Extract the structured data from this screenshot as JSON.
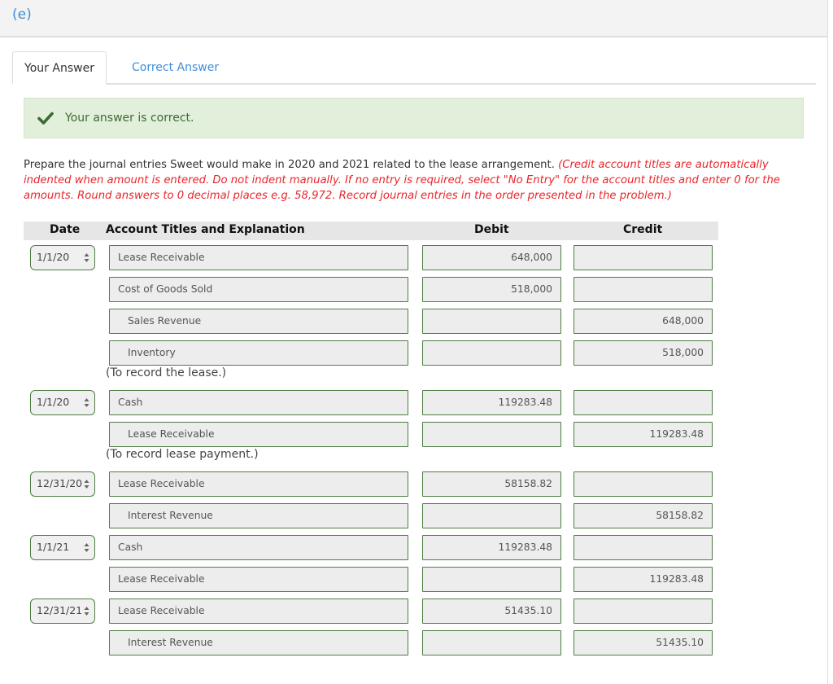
{
  "part_label": "(e)",
  "tabs": [
    {
      "label": "Your Answer",
      "active": true
    },
    {
      "label": "Correct Answer",
      "active": false
    }
  ],
  "alert": {
    "icon": "checkmark-icon",
    "message": "Your answer is correct.",
    "color": "#3b6b34",
    "background": "#e2efda"
  },
  "instructions": {
    "prompt": "Prepare the journal entries Sweet would make in 2020 and 2021 related to the lease arrangement. ",
    "note": "(Credit account titles are automatically indented when amount is entered. Do not indent manually. If no entry is required, select \"No Entry\" for the account titles and enter 0 for the amounts. Round answers to 0 decimal places e.g. 58,972. Record journal entries in the order presented in the problem.)",
    "note_color": "#e8252a"
  },
  "table": {
    "headers": {
      "date": "Date",
      "account": "Account Titles and Explanation",
      "debit": "Debit",
      "credit": "Credit"
    },
    "entries": [
      {
        "date": "1/1/20",
        "lines": [
          {
            "account": "Lease Receivable",
            "indent": false,
            "debit": "648,000",
            "credit": ""
          },
          {
            "account": "Cost of Goods Sold",
            "indent": false,
            "debit": "518,000",
            "credit": ""
          },
          {
            "account": "Sales Revenue",
            "indent": true,
            "debit": "",
            "credit": "648,000"
          },
          {
            "account": "Inventory",
            "indent": true,
            "debit": "",
            "credit": "518,000"
          }
        ],
        "explanation": "(To record the lease.)"
      },
      {
        "date": "1/1/20",
        "lines": [
          {
            "account": "Cash",
            "indent": false,
            "debit": "119283.48",
            "credit": ""
          },
          {
            "account": "Lease Receivable",
            "indent": true,
            "debit": "",
            "credit": "119283.48"
          }
        ],
        "explanation": "(To record lease payment.)"
      },
      {
        "date": "12/31/20",
        "lines": [
          {
            "account": "Lease Receivable",
            "indent": false,
            "debit": "58158.82",
            "credit": ""
          },
          {
            "account": "Interest Revenue",
            "indent": true,
            "debit": "",
            "credit": "58158.82"
          }
        ],
        "explanation": ""
      },
      {
        "date": "1/1/21",
        "lines": [
          {
            "account": "Cash",
            "indent": false,
            "debit": "119283.48",
            "credit": ""
          },
          {
            "account": "Lease Receivable",
            "indent": false,
            "debit": "",
            "credit": "119283.48"
          }
        ],
        "explanation": ""
      },
      {
        "date": "12/31/21",
        "lines": [
          {
            "account": "Lease Receivable",
            "indent": false,
            "debit": "51435.10",
            "credit": ""
          },
          {
            "account": "Interest Revenue",
            "indent": true,
            "debit": "",
            "credit": "51435.10"
          }
        ],
        "explanation": ""
      }
    ]
  }
}
